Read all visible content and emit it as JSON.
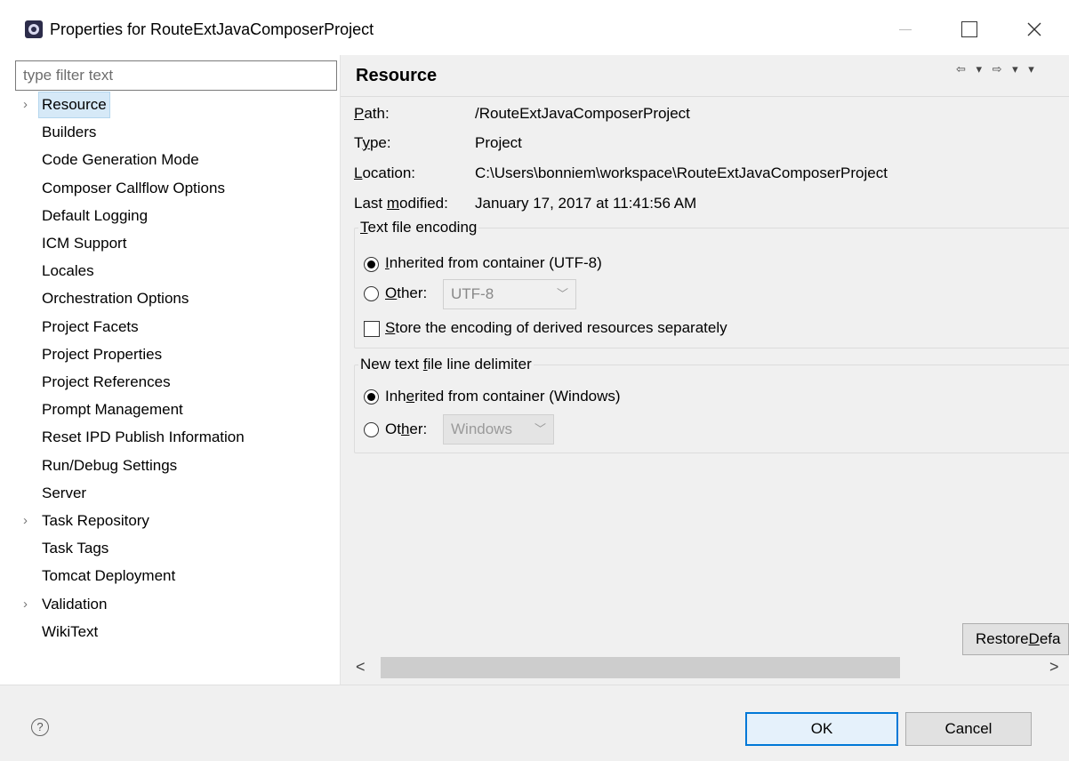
{
  "window": {
    "title": "Properties for RouteExtJavaComposerProject",
    "minimize_icon": "minimize-icon",
    "maximize_icon": "maximize-icon",
    "close_icon": "close-icon"
  },
  "filter": {
    "placeholder": "type filter text"
  },
  "tree": {
    "items": [
      {
        "label": "Resource",
        "expandable": true,
        "selected": true
      },
      {
        "label": "Builders",
        "expandable": false
      },
      {
        "label": "Code Generation Mode",
        "expandable": false
      },
      {
        "label": "Composer Callflow Options",
        "expandable": false
      },
      {
        "label": "Default Logging",
        "expandable": false
      },
      {
        "label": "ICM Support",
        "expandable": false
      },
      {
        "label": "Locales",
        "expandable": false
      },
      {
        "label": "Orchestration Options",
        "expandable": false
      },
      {
        "label": "Project Facets",
        "expandable": false
      },
      {
        "label": "Project Properties",
        "expandable": false
      },
      {
        "label": "Project References",
        "expandable": false
      },
      {
        "label": "Prompt Management",
        "expandable": false
      },
      {
        "label": "Reset IPD Publish Information",
        "expandable": false
      },
      {
        "label": "Run/Debug Settings",
        "expandable": false
      },
      {
        "label": "Server",
        "expandable": false
      },
      {
        "label": "Task Repository",
        "expandable": true
      },
      {
        "label": "Task Tags",
        "expandable": false
      },
      {
        "label": "Tomcat Deployment",
        "expandable": false
      },
      {
        "label": "Validation",
        "expandable": true
      },
      {
        "label": "WikiText",
        "expandable": false
      }
    ]
  },
  "page": {
    "title": "Resource",
    "nav_icons": "⇦ ▾ ⇨ ▾ ▾",
    "path_label": "ath:",
    "path_label_u": "P",
    "path_value": "/RouteExtJavaComposerProject",
    "type_label_pre": "T",
    "type_label_u": "y",
    "type_label_post": "pe:",
    "type_value": "Project",
    "location_label_u": "L",
    "location_label": "ocation:",
    "location_value": "C:\\Users\\bonniem\\workspace\\RouteExtJavaComposerProject",
    "modified_label_pre": "Last ",
    "modified_label_u": "m",
    "modified_label_post": "odified:",
    "modified_value": "January 17, 2017 at 11:41:56 AM"
  },
  "encoding": {
    "legend_u": "T",
    "legend": "ext file encoding",
    "inherited_u": "I",
    "inherited": "nherited from container (UTF-8)",
    "other_u": "O",
    "other": "ther:",
    "other_value": "UTF-8",
    "store_u": "S",
    "store": "tore the encoding of derived resources separately"
  },
  "delimiter": {
    "legend_pre": "New text ",
    "legend_u": "f",
    "legend_post": "ile line delimiter",
    "inherited_pre": "Inh",
    "inherited_u": "e",
    "inherited_post": "rited from container (Windows)",
    "other_pre": "Ot",
    "other_u": "h",
    "other_post": "er:",
    "other_value": "Windows"
  },
  "buttons": {
    "restore_pre": "Restore ",
    "restore_u": "D",
    "restore_post": "efa",
    "ok": "OK",
    "cancel": "Cancel"
  },
  "scroll": {
    "left_arrow": "<",
    "right_arrow": ">"
  },
  "help": {
    "glyph": "?"
  }
}
